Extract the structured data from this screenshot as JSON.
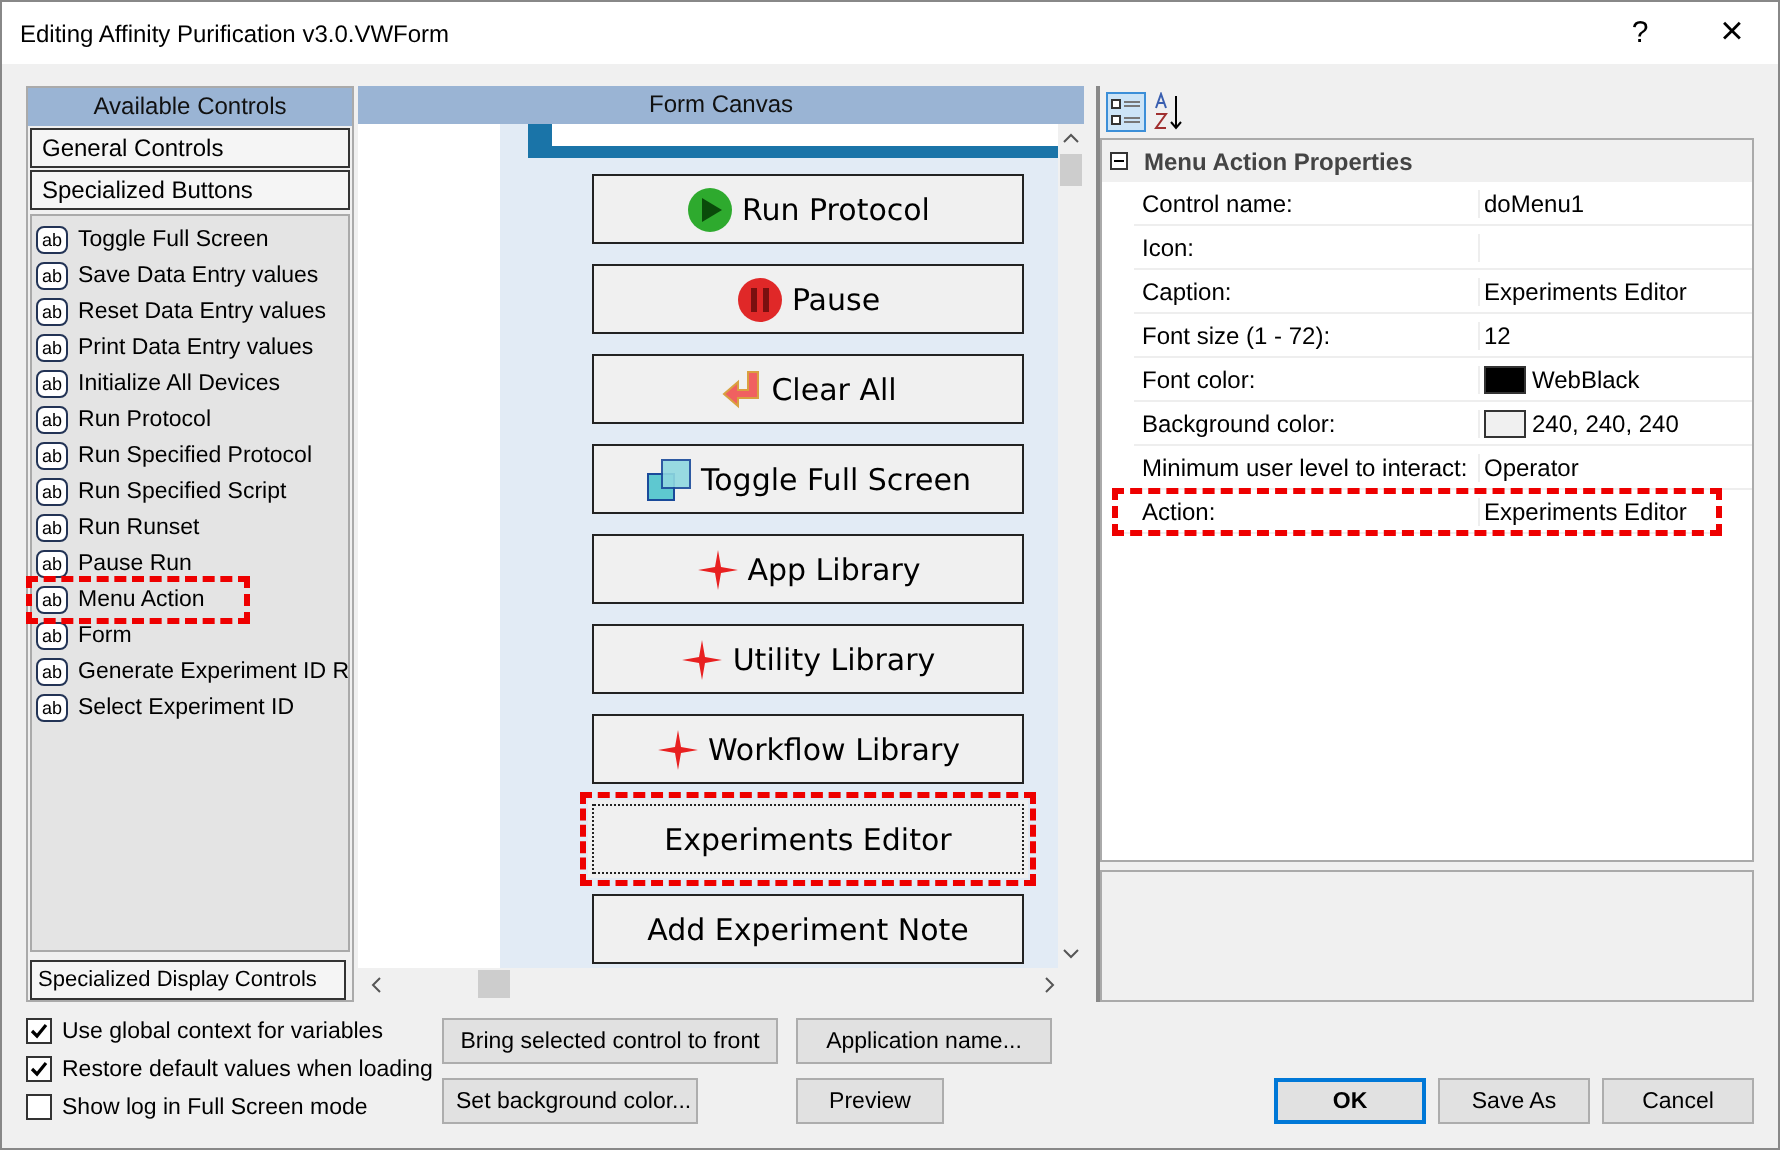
{
  "window": {
    "title": "Editing Affinity Purification v3.0.VWForm",
    "help": "?",
    "close": "×"
  },
  "available_controls": {
    "title": "Available Controls",
    "groups": [
      {
        "label": "General Controls"
      },
      {
        "label": "Specialized Buttons"
      }
    ],
    "items": [
      {
        "label": "Toggle Full Screen",
        "icon_text": "ab",
        "highlighted": false
      },
      {
        "label": "Save Data Entry values",
        "icon_text": "ab",
        "highlighted": false
      },
      {
        "label": "Reset Data Entry values",
        "icon_text": "ab",
        "highlighted": false
      },
      {
        "label": "Print Data Entry values",
        "icon_text": "ab",
        "highlighted": false
      },
      {
        "label": "Initialize All Devices",
        "icon_text": "ab",
        "highlighted": false
      },
      {
        "label": "Run Protocol",
        "icon_text": "ab",
        "highlighted": false
      },
      {
        "label": "Run Specified Protocol",
        "icon_text": "ab",
        "highlighted": false
      },
      {
        "label": "Run Specified Script",
        "icon_text": "ab",
        "highlighted": false
      },
      {
        "label": "Run Runset",
        "icon_text": "ab",
        "highlighted": false
      },
      {
        "label": "Pause Run",
        "icon_text": "ab",
        "highlighted": false
      },
      {
        "label": "Menu Action",
        "icon_text": "ab",
        "highlighted": true
      },
      {
        "label": "Form",
        "icon_text": "ab",
        "highlighted": false
      },
      {
        "label": "Generate Experiment ID R",
        "icon_text": "ab",
        "highlighted": false
      },
      {
        "label": "Select Experiment ID",
        "icon_text": "ab",
        "highlighted": false
      }
    ],
    "bottom_group": "Specialized Display Controls"
  },
  "form_canvas": {
    "title": "Form Canvas",
    "buttons": [
      {
        "caption": "Run Protocol",
        "kind": "play",
        "selected": false
      },
      {
        "caption": "Pause",
        "kind": "pause",
        "selected": false
      },
      {
        "caption": "Clear All",
        "kind": "clear",
        "selected": false
      },
      {
        "caption": "Toggle Full Screen",
        "kind": "fullscreen",
        "selected": false
      },
      {
        "caption": "App Library",
        "kind": "star",
        "selected": false
      },
      {
        "caption": "Utility Library",
        "kind": "star",
        "selected": false
      },
      {
        "caption": "Workflow Library",
        "kind": "star",
        "selected": false
      },
      {
        "caption": "Experiments Editor",
        "kind": "none",
        "selected": true
      },
      {
        "caption": "Add Experiment Note",
        "kind": "none",
        "selected": false
      }
    ]
  },
  "properties": {
    "category": "Menu Action Properties",
    "expanded": true,
    "rows": [
      {
        "name": "Control name:",
        "value": "doMenu1",
        "highlighted": false
      },
      {
        "name": "Icon:",
        "value": "",
        "highlighted": false
      },
      {
        "name": "Caption:",
        "value": "Experiments Editor",
        "highlighted": false
      },
      {
        "name": "Font size (1 - 72):",
        "value": "12",
        "highlighted": false
      },
      {
        "name": "Font color:",
        "value": "WebBlack",
        "color": "#000000",
        "highlighted": false
      },
      {
        "name": "Background color:",
        "value": "240, 240, 240",
        "color": "#f0f0f0",
        "highlighted": false
      },
      {
        "name": "Minimum user level to interact:",
        "value": "Operator",
        "highlighted": false
      },
      {
        "name": "Action:",
        "value": "Experiments Editor",
        "highlighted": true
      }
    ]
  },
  "options": [
    {
      "label": "Use global context for variables",
      "checked": true
    },
    {
      "label": "Restore default values when loading",
      "checked": true
    },
    {
      "label": "Show log in Full Screen mode",
      "checked": false
    }
  ],
  "buttons": {
    "bring_to_front": "Bring selected control to front",
    "application_name": "Application name...",
    "background_color": "Set background color...",
    "preview": "Preview",
    "ok": "OK",
    "save_as": "Save As",
    "cancel": "Cancel"
  }
}
